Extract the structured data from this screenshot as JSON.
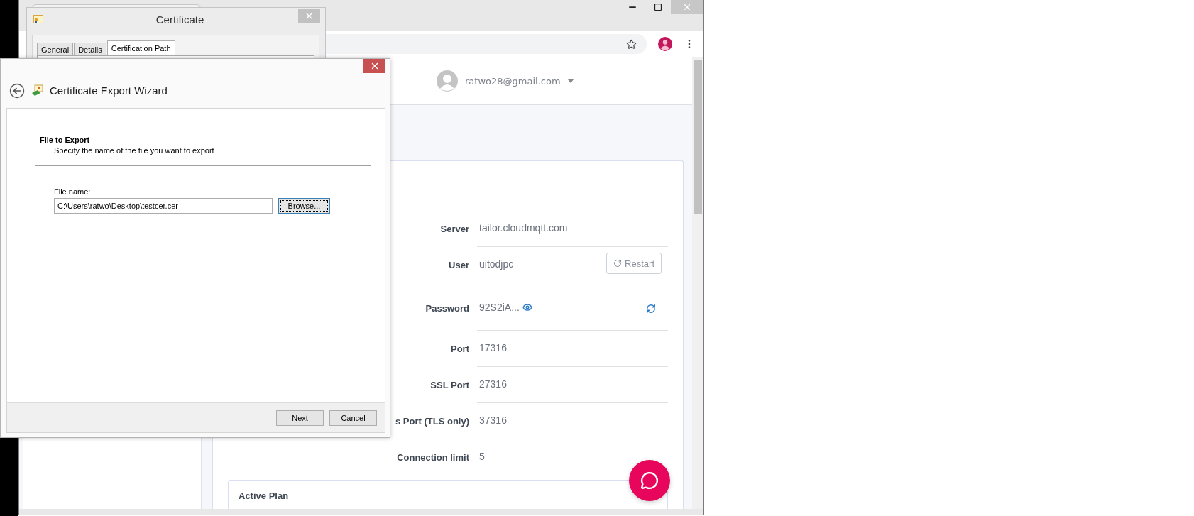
{
  "browser": {
    "account_email": "ratwo28@gmail.com",
    "details": [
      {
        "kind": "plain",
        "label": "Server",
        "value": "tailor.cloudmqtt.com"
      },
      {
        "kind": "action",
        "label": "User",
        "value": "uitodjpc",
        "action": "Restart"
      },
      {
        "kind": "secret",
        "label": "Password",
        "value": "92S2iA..."
      },
      {
        "kind": "plain",
        "label": "Port",
        "value": "17316"
      },
      {
        "kind": "plain",
        "label": "SSL Port",
        "value": "27316"
      },
      {
        "kind": "plain",
        "label": "s Port (TLS only)",
        "value": "37316"
      },
      {
        "kind": "plain",
        "label": "Connection limit",
        "value": "5"
      }
    ],
    "plan_card": {
      "title": "Active Plan"
    }
  },
  "certificate_dialog": {
    "title": "Certificate",
    "tabs": [
      {
        "label": "General",
        "selected": false
      },
      {
        "label": "Details",
        "selected": false
      },
      {
        "label": "Certification Path",
        "selected": true
      }
    ]
  },
  "wizard": {
    "title": "Certificate Export Wizard",
    "heading": "File to Export",
    "description": "Specify the name of the file you want to export",
    "file_label": "File name:",
    "file_value": "C:\\Users\\ratwo\\Desktop\\testcer.cer",
    "browse": {
      "label": "Browse...",
      "focused": true
    },
    "buttons": [
      "Next",
      "Cancel"
    ]
  }
}
